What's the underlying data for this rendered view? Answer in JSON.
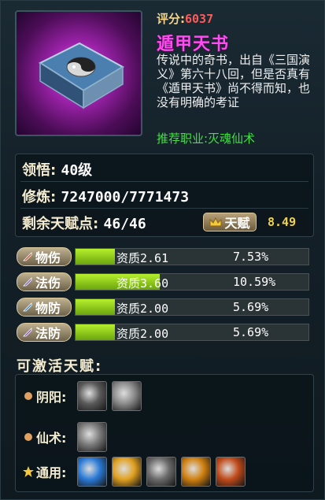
{
  "item": {
    "score_label": "评分:",
    "score_value": "6037",
    "name": "遁甲天书",
    "description": "传说中的奇书，出自《三国演义》第六十八回，但是否真有《遁甲天书》尚不得而知，也没有明确的考证",
    "recommend": "推荐职业:灭魂仙术"
  },
  "stats": {
    "comprehension_label": "领悟:",
    "comprehension_value": "40级",
    "cultivation_label": "修炼:",
    "cultivation_value": "7247000/7771473",
    "talent_points_label": "剩余天赋点:",
    "talent_points_value": "46/46",
    "talent_button": "天赋",
    "talent_value": "8.49"
  },
  "attributes": [
    {
      "tag": "物伤",
      "quality": "资质2.61",
      "percent": "7.53%",
      "fill": 0.17,
      "icon": "sword-icon",
      "color": "#d44b2c"
    },
    {
      "tag": "法伤",
      "quality": "资质3.60",
      "percent": "10.59%",
      "fill": 0.36,
      "icon": "lightning-icon",
      "color": "#7e5bd6"
    },
    {
      "tag": "物防",
      "quality": "资质2.00",
      "percent": "5.69%",
      "fill": 0.17,
      "icon": "shield-icon",
      "color": "#3a88d6"
    },
    {
      "tag": "法防",
      "quality": "资质2.00",
      "percent": "5.69%",
      "fill": 0.17,
      "icon": "magic-shield-icon",
      "color": "#8a4fd8"
    }
  ],
  "activatable": {
    "title": "可激活天赋:",
    "rows": [
      {
        "label": "阴阳:",
        "icon": "staff-icon",
        "skills": 2
      },
      {
        "label": "仙术:",
        "icon": "scroll-icon",
        "skills": 1
      },
      {
        "label": "通用:",
        "icon": "star-icon",
        "skills": 5
      }
    ]
  }
}
